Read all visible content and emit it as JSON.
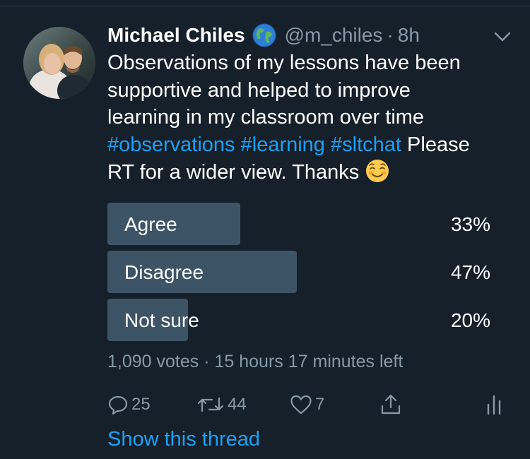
{
  "tweet": {
    "author_name": "Michael Chiles",
    "handle": "@m_chiles",
    "separator": "·",
    "time": "8h",
    "body_line1": "Observations of my lessons have been",
    "body_line2": "supportive and helped to improve",
    "body_line3": "learning in my classroom over time",
    "hashtag1": "#observations",
    "hashtag2": "#learning",
    "hashtag3": "#sltchat",
    "body_after_tags": "Please",
    "body_line5": "RT for a wider view. Thanks",
    "icons": {
      "globe": "globe-emoji",
      "smile": "smiling-face-emoji",
      "menu": "chevron-down-icon"
    }
  },
  "poll": {
    "options": [
      {
        "label": "Agree",
        "percent_text": "33%",
        "percent": 33
      },
      {
        "label": "Disagree",
        "percent_text": "47%",
        "percent": 47
      },
      {
        "label": "Not sure",
        "percent_text": "20%",
        "percent": 20
      }
    ],
    "votes_text": "1,090 votes",
    "separator": "·",
    "time_left": "15 hours 17 minutes left"
  },
  "actions": {
    "reply_count": "25",
    "retweet_count": "44",
    "like_count": "7"
  },
  "show_thread_label": "Show this thread",
  "colors": {
    "background": "#15202b",
    "accent": "#1da1f2",
    "muted": "#8899a6",
    "poll_bar": "#3d5466"
  }
}
